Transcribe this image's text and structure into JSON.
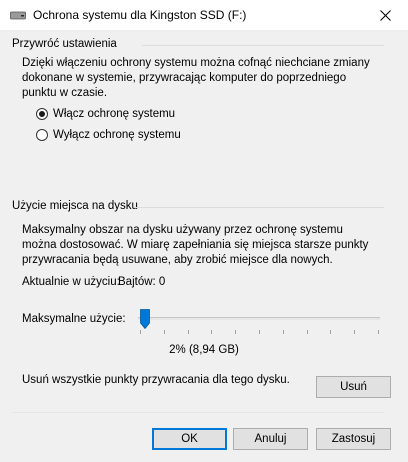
{
  "window": {
    "title": "Ochrona systemu dla Kingston SSD (F:)",
    "close_icon": "close-icon",
    "drive_icon": "drive-icon"
  },
  "restore": {
    "title": "Przywróć ustawienia",
    "description": "Dzięki włączeniu ochrony systemu można cofnąć niechciane zmiany dokonane w systemie, przywracając komputer do poprzedniego punktu w czasie.",
    "options": [
      {
        "label": "Włącz ochronę systemu",
        "selected": true
      },
      {
        "label": "Wyłącz ochronę systemu",
        "selected": false
      }
    ]
  },
  "disk_usage": {
    "title": "Użycie miejsca na dysku",
    "description": "Maksymalny obszar na dysku używany przez ochronę systemu można dostosować. W miarę zapełniania się miejsca starsze punkty przywracania będą usuwane, aby zrobić miejsce dla nowych.",
    "current_label": "Aktualnie w użyciu:",
    "current_value": "Bajtów: 0",
    "max_label": "Maksymalne użycie:",
    "slider_percent": 2,
    "slider_value_text": "2% (8,94 GB)",
    "delete_text": "Usuń wszystkie punkty przywracania dla tego dysku.",
    "delete_button": "Usuń"
  },
  "footer": {
    "ok": "OK",
    "cancel": "Anuluj",
    "apply": "Zastosuj"
  },
  "colors": {
    "accent": "#0078d7",
    "background": "#f0f0f0"
  }
}
